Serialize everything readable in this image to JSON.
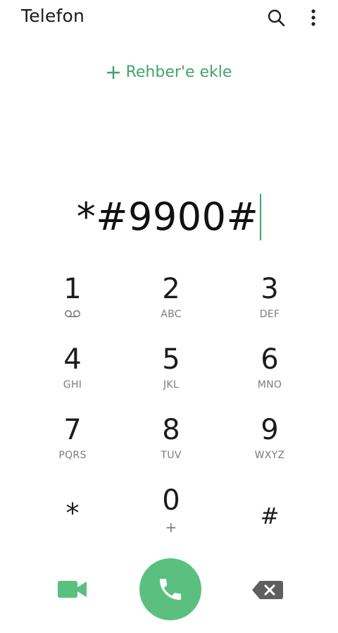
{
  "header": {
    "title": "Telefon",
    "search_icon": "search-icon",
    "more_icon": "more-vertical-icon"
  },
  "add_contact": {
    "label": "Rehber'e ekle",
    "icon": "plus-icon"
  },
  "dial_input": {
    "value": "*#9900#"
  },
  "keypad": [
    {
      "digit": "1",
      "sub": "",
      "sub_icon": "voicemail-icon"
    },
    {
      "digit": "2",
      "sub": "ABC"
    },
    {
      "digit": "3",
      "sub": "DEF"
    },
    {
      "digit": "4",
      "sub": "GHI"
    },
    {
      "digit": "5",
      "sub": "JKL"
    },
    {
      "digit": "6",
      "sub": "MNO"
    },
    {
      "digit": "7",
      "sub": "PQRS"
    },
    {
      "digit": "8",
      "sub": "TUV"
    },
    {
      "digit": "9",
      "sub": "WXYZ"
    },
    {
      "digit": "*",
      "sub": ""
    },
    {
      "digit": "0",
      "sub": "+"
    },
    {
      "digit": "#",
      "sub": ""
    }
  ],
  "bottom_bar": {
    "video_icon": "video-call-icon",
    "call_icon": "phone-icon",
    "backspace_icon": "backspace-icon"
  },
  "colors": {
    "accent": "#43a36b",
    "call_button": "#5bbf80",
    "pressed_key": "#ececec",
    "icon_gray": "#5f5f5f"
  }
}
